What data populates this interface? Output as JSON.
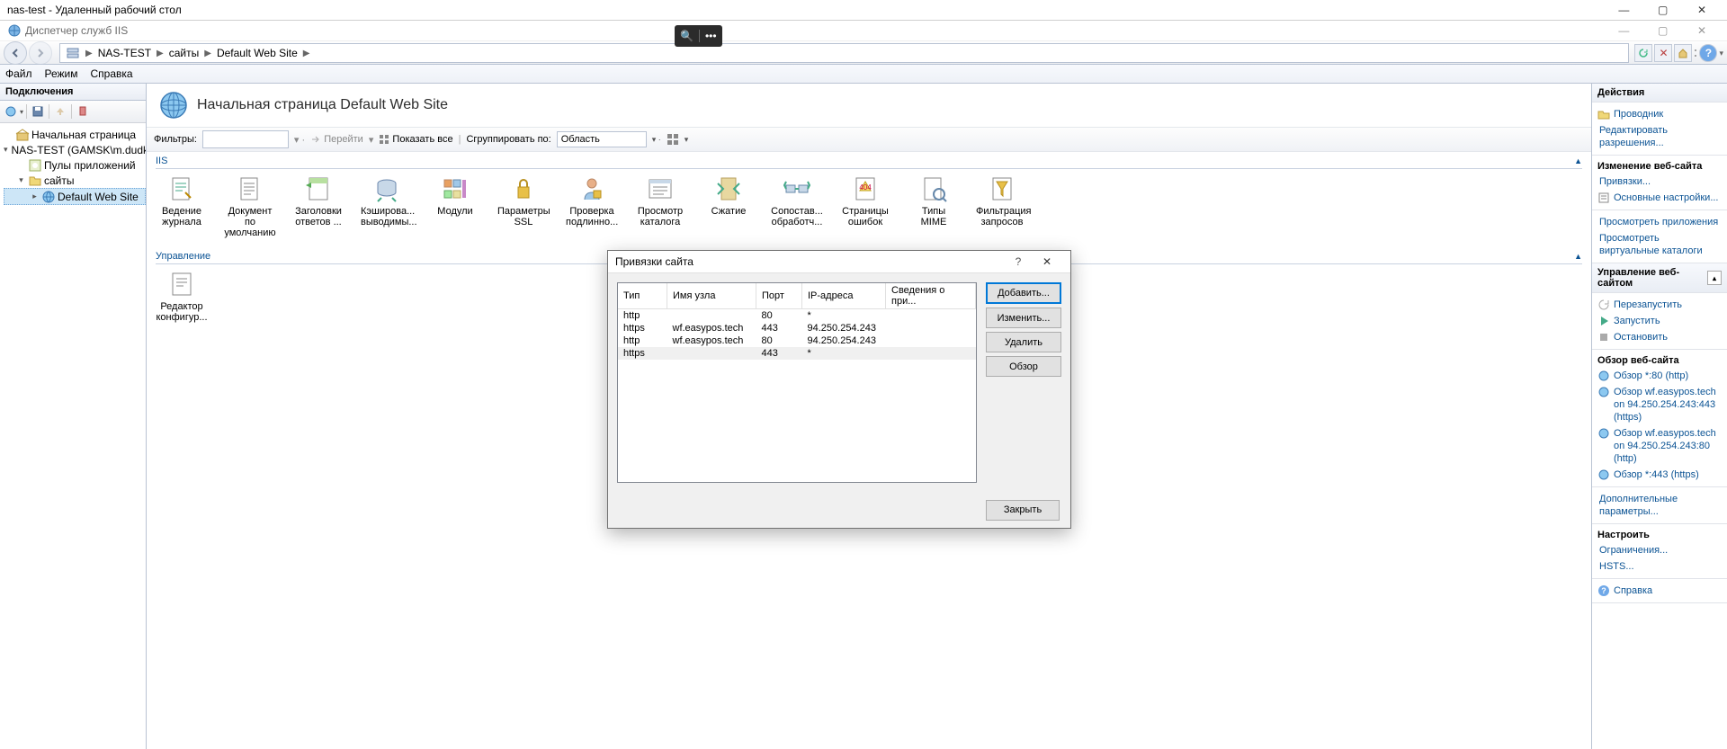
{
  "rdp": {
    "title": "nas-test - Удаленный рабочий стол"
  },
  "iis": {
    "title": "Диспетчер служб IIS"
  },
  "breadcrumb": {
    "host": "NAS-TEST",
    "sites": "сайты",
    "site": "Default Web Site"
  },
  "menu": {
    "file": "Файл",
    "mode": "Режим",
    "help": "Справка"
  },
  "connections": {
    "title": "Подключения",
    "start_page": "Начальная страница",
    "server": "NAS-TEST (GAMSK\\m.dudko)",
    "app_pools": "Пулы приложений",
    "sites": "сайты",
    "default_site": "Default Web Site"
  },
  "page": {
    "title": "Начальная страница Default Web Site",
    "filter_label": "Фильтры:",
    "go": "Перейти",
    "show_all": "Показать все",
    "group_by": "Сгруппировать по:",
    "group_by_value": "Область",
    "iis_group": "IIS",
    "manage_group": "Управление",
    "features": {
      "logging": "Ведение журнала",
      "default_doc": "Документ по умолчанию",
      "response_headers": "Заголовки ответов ...",
      "output_cache": "Кэширова... выводимы...",
      "modules": "Модули",
      "ssl": "Параметры SSL",
      "auth": "Проверка подлинно...",
      "dir_browse": "Просмотр каталога",
      "compression": "Сжатие",
      "handlers": "Сопостав... обработч...",
      "error_pages": "Страницы ошибок",
      "mime": "Типы MIME",
      "filtering": "Фильтрация запросов",
      "config_editor": "Редактор конфигур..."
    }
  },
  "actions": {
    "title": "Действия",
    "explorer": "Проводник",
    "edit_perm": "Редактировать разрешения...",
    "edit_site": "Изменение веб-сайта",
    "bindings": "Привязки...",
    "basic": "Основные настройки...",
    "apps": "Просмотреть приложения",
    "vdirs": "Просмотреть виртуальные каталоги",
    "manage": "Управление веб-сайтом",
    "restart": "Перезапустить",
    "start": "Запустить",
    "stop": "Остановить",
    "browse_h": "Обзор веб-сайта",
    "b1": "Обзор *:80 (http)",
    "b2": "Обзор wf.easypos.tech on 94.250.254.243:443 (https)",
    "b3": "Обзор wf.easypos.tech on 94.250.254.243:80 (http)",
    "b4": "Обзор *:443 (https)",
    "adv": "Дополнительные параметры...",
    "configure": "Настроить",
    "limits": "Ограничения...",
    "hsts": "HSTS...",
    "help": "Справка"
  },
  "dialog": {
    "title": "Привязки сайта",
    "cols": {
      "type": "Тип",
      "host": "Имя узла",
      "port": "Порт",
      "ip": "IP-адреса",
      "info": "Сведения о при..."
    },
    "rows": [
      {
        "type": "http",
        "host": "",
        "port": "80",
        "ip": "*"
      },
      {
        "type": "https",
        "host": "wf.easypos.tech",
        "port": "443",
        "ip": "94.250.254.243"
      },
      {
        "type": "http",
        "host": "wf.easypos.tech",
        "port": "80",
        "ip": "94.250.254.243"
      },
      {
        "type": "https",
        "host": "",
        "port": "443",
        "ip": "*"
      }
    ],
    "add": "Добавить...",
    "edit": "Изменить...",
    "delete": "Удалить",
    "browse": "Обзор",
    "close": "Закрыть"
  }
}
